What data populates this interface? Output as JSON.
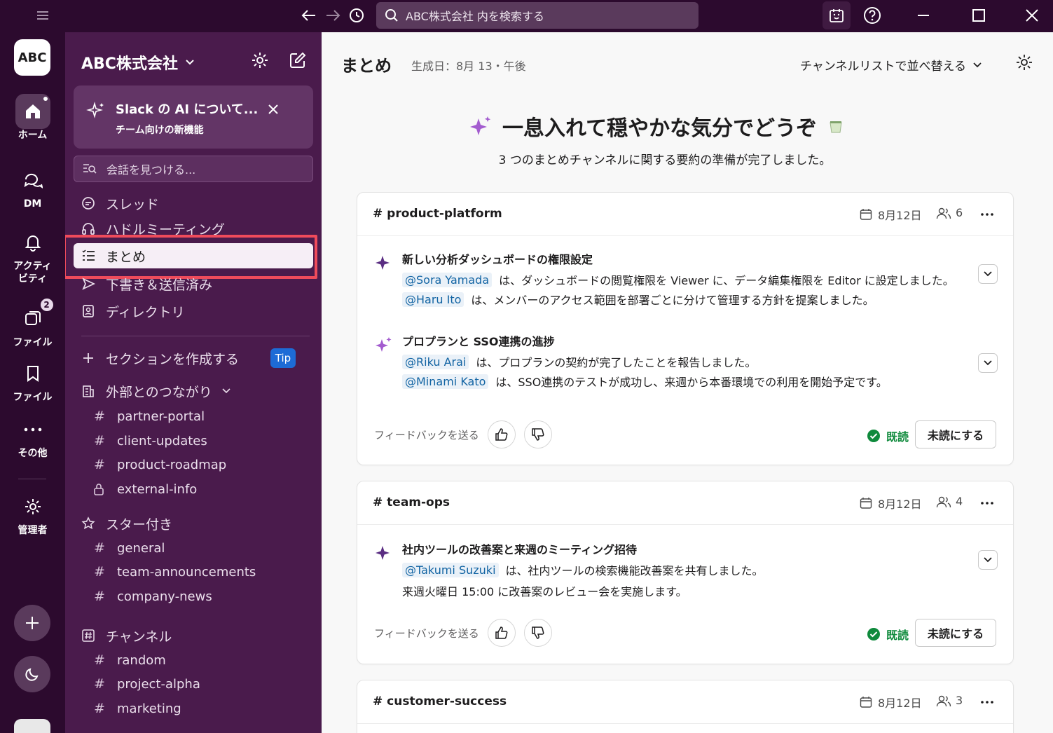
{
  "topbar": {
    "search_placeholder": "ABC株式会社 内を検索する",
    "icons": [
      "menu-icon",
      "back-icon",
      "forward-icon",
      "history-icon",
      "search-icon",
      "huddle-icon",
      "help-icon",
      "minimize-icon",
      "maximize-icon",
      "close-icon"
    ]
  },
  "rail": {
    "workspace_logo": "ABC",
    "items": [
      {
        "label": "ホーム",
        "icon": "home-icon",
        "active": true
      },
      {
        "label": "DM",
        "icon": "dm-icon"
      },
      {
        "label": "アクティビティ",
        "icon": "bell-icon"
      },
      {
        "label": "ファイル",
        "icon": "files-icon",
        "badge": "2"
      },
      {
        "label": "ファイル",
        "icon": "bookmark-icon"
      },
      {
        "label": "その他",
        "icon": "more-icon"
      },
      {
        "label": "管理者",
        "icon": "gear-icon"
      }
    ],
    "rail_label_activity_line1": "アクティ",
    "rail_label_activity_line2": "ビティ"
  },
  "sidebar": {
    "workspace_name": "ABC株式会社",
    "ai_card": {
      "title": "Slack の AI について...",
      "subtitle": "チーム向けの新機能"
    },
    "find_placeholder": "会話を見つける...",
    "nav": [
      {
        "label": "スレッド",
        "icon": "threads-icon"
      },
      {
        "label": "ハドルミーティング",
        "icon": "headphones-icon"
      },
      {
        "label": "まとめ",
        "icon": "recap-icon",
        "selected": true
      },
      {
        "label": "下書き＆送信済み",
        "icon": "send-icon"
      },
      {
        "label": "ディレクトリ",
        "icon": "directory-icon"
      }
    ],
    "create_section": "セクションを作成する",
    "tip": "Tip",
    "external": {
      "label": "外部とのつながり",
      "channels": [
        "partner-portal",
        "client-updates",
        "product-roadmap",
        "external-info"
      ]
    },
    "starred": {
      "label": "スター付き",
      "channels": [
        "general",
        "team-announcements",
        "company-news"
      ]
    },
    "channels": {
      "label": "チャンネル",
      "channels": [
        "random",
        "project-alpha",
        "marketing"
      ]
    }
  },
  "main": {
    "title": "まとめ",
    "generated": "生成日：8月 13・午後",
    "sort_label": "チャンネルリストで並べ替える",
    "hero_title": "一息入れて穏やかな気分でどうぞ",
    "hero_sub": "3 つのまとめチャンネルに関する要約の準備が完了しました。",
    "feedback_label": "フィードバックを送る",
    "read_label": "既読",
    "unread_button": "未読にする",
    "cards": [
      {
        "channel": "# product-platform",
        "date": "8月12日",
        "count": "6",
        "topics": [
          {
            "title": "新しい分析ダッシュボードの権限設定",
            "lines": [
              {
                "mention": "@Sora Yamada",
                "text": "は、ダッシュボードの閲覧権限を Viewer に、データ編集権限を Editor に設定しました。"
              },
              {
                "mention": "@Haru Ito",
                "text": "は、メンバーのアクセス範囲を部署ごとに分けて管理する方針を提案しました。"
              }
            ]
          },
          {
            "title": "プロプランと SSO連携の進捗",
            "lines": [
              {
                "mention": "@Riku Arai",
                "text": "は、プロプランの契約が完了したことを報告しました。"
              },
              {
                "mention": "@Minami Kato",
                "text": "は、SSO連携のテストが成功し、来週から本番環境での利用を開始予定です。"
              }
            ]
          }
        ]
      },
      {
        "channel": "# team-ops",
        "date": "8月12日",
        "count": "4",
        "topics": [
          {
            "title": "社内ツールの改善案と来週のミーティング招待",
            "lines": [
              {
                "mention": "@Takumi Suzuki",
                "text": "は、社内ツールの検索機能改善案を共有しました。"
              },
              {
                "mention": "",
                "text": "来週火曜日 15:00 に改善案のレビュー会を実施します。"
              }
            ]
          }
        ]
      },
      {
        "channel": "# customer-success",
        "date": "8月12日",
        "count": "3"
      }
    ]
  },
  "colors": {
    "rail_bg": "#2c0a2e",
    "sidebar_bg": "#4a1b4c",
    "highlight": "#ef4b5b",
    "mention": "#1264a3",
    "read": "#0f8a3c",
    "tip": "#1d6bd6"
  }
}
